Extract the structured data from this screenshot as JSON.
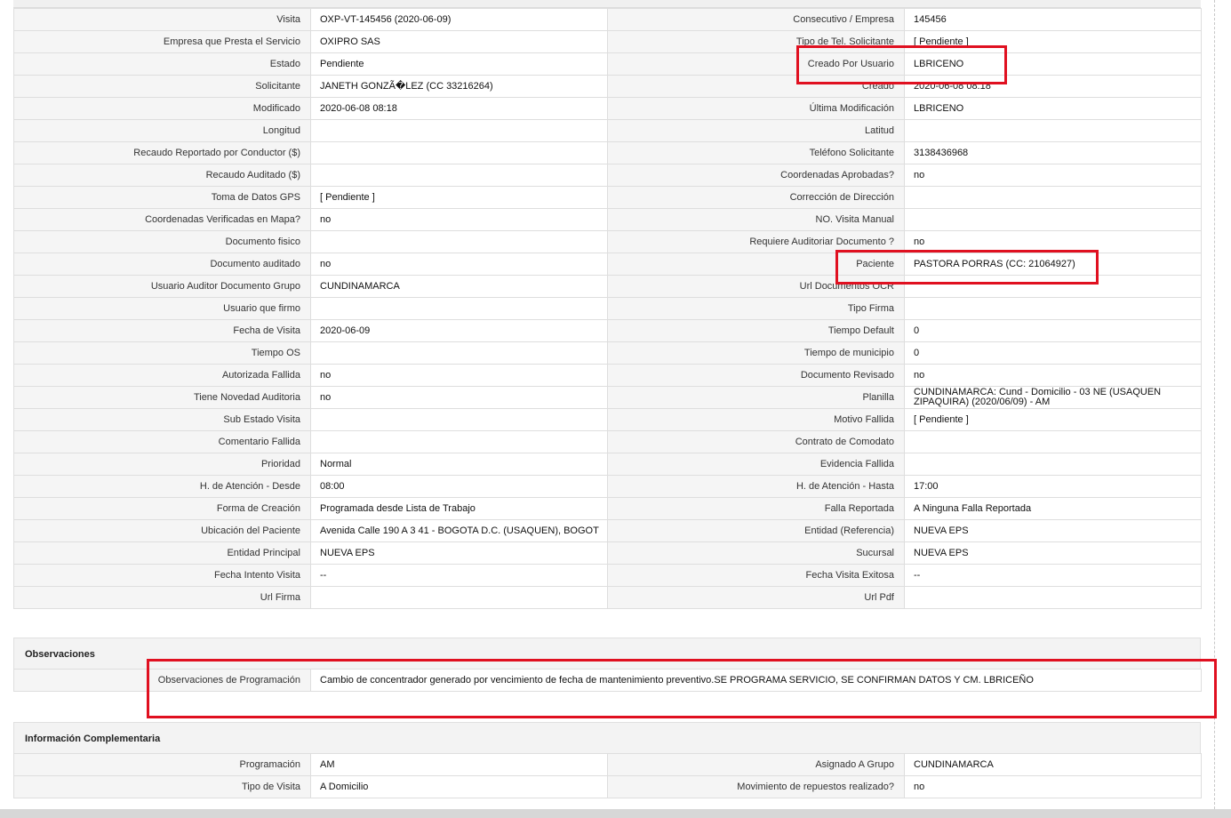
{
  "main_rows": [
    {
      "l1": "Visita",
      "v1": "OXP-VT-145456 (2020-06-09)",
      "l2": "Consecutivo / Empresa",
      "v2": "145456"
    },
    {
      "l1": "Empresa que Presta el Servicio",
      "v1": "OXIPRO SAS",
      "l2": "Tipo de Tel. Solicitante",
      "v2": "[ Pendiente ]"
    },
    {
      "l1": "Estado",
      "v1": "Pendiente",
      "l2": "Creado Por Usuario",
      "v2": "LBRICENO"
    },
    {
      "l1": "Solicitante",
      "v1": "JANETH GONZÃ�LEZ (CC 33216264)",
      "l2": "Creado",
      "v2": "2020-06-08 08:18"
    },
    {
      "l1": "Modificado",
      "v1": "2020-06-08 08:18",
      "l2": "Última Modificación",
      "v2": " LBRICENO"
    },
    {
      "l1": "Longitud",
      "v1": "",
      "l2": "Latitud",
      "v2": ""
    },
    {
      "l1": "Recaudo Reportado por Conductor ($)",
      "v1": "",
      "l2": "Teléfono Solicitante",
      "v2": "3138436968"
    },
    {
      "l1": "Recaudo Auditado ($)",
      "v1": "",
      "l2": "Coordenadas Aprobadas?",
      "v2": " no"
    },
    {
      "l1": "Toma de Datos GPS",
      "v1": "[ Pendiente ]",
      "l2": "Corrección de Dirección",
      "v2": ""
    },
    {
      "l1": "Coordenadas Verificadas en Mapa?",
      "v1": " no",
      "l2": "NO. Visita Manual",
      "v2": ""
    },
    {
      "l1": "Documento fisico",
      "v1": "",
      "l2": "Requiere Auditoriar Documento ?",
      "v2": " no"
    },
    {
      "l1": "Documento auditado",
      "v1": " no",
      "l2": "Paciente",
      "v2": "PASTORA PORRAS (CC: 21064927)"
    },
    {
      "l1": "Usuario Auditor Documento Grupo",
      "v1": "CUNDINAMARCA",
      "l2": "Url Documentos OCR",
      "v2": ""
    },
    {
      "l1": "Usuario que firmo",
      "v1": "",
      "l2": "Tipo Firma",
      "v2": ""
    },
    {
      "l1": "Fecha de Visita",
      "v1": " 2020-06-09",
      "l2": "Tiempo Default",
      "v2": "0"
    },
    {
      "l1": "Tiempo OS",
      "v1": "",
      "l2": "Tiempo de municipio",
      "v2": "0"
    },
    {
      "l1": "Autorizada Fallida",
      "v1": " no",
      "l2": "Documento Revisado",
      "v2": " no"
    },
    {
      "l1": "Tiene Novedad Auditoria",
      "v1": " no",
      "l2": "Planilla",
      "v2": "CUNDINAMARCA: Cund - Domicilio - 03 NE (USAQUEN ZIPAQUIRA) (2020/06/09) - AM"
    },
    {
      "l1": "Sub Estado Visita",
      "v1": "",
      "l2": "Motivo Fallida",
      "v2": "[ Pendiente ]"
    },
    {
      "l1": "Comentario Fallida",
      "v1": "",
      "l2": "Contrato de Comodato",
      "v2": ""
    },
    {
      "l1": "Prioridad",
      "v1": "Normal",
      "l2": "Evidencia Fallida",
      "v2": ""
    },
    {
      "l1": "H. de Atención - Desde",
      "v1": "08:00",
      "l2": "H. de Atención - Hasta",
      "v2": "17:00"
    },
    {
      "l1": "Forma de Creación",
      "v1": "Programada desde Lista de Trabajo",
      "l2": "Falla Reportada",
      "v2": "A Ninguna Falla Reportada"
    },
    {
      "l1": "Ubicación del Paciente",
      "v1": "Avenida Calle 190 A 3 41 - BOGOTA D.C. (USAQUEN), BOGOT",
      "l2": "Entidad (Referencia)",
      "v2": "NUEVA EPS"
    },
    {
      "l1": "Entidad Principal",
      "v1": "NUEVA EPS",
      "l2": "Sucursal",
      "v2": "NUEVA EPS"
    },
    {
      "l1": "Fecha Intento Visita",
      "v1": " --",
      "l2": "Fecha Visita Exitosa",
      "v2": " --"
    },
    {
      "l1": "Url Firma",
      "v1": "",
      "l2": "Url Pdf",
      "v2": ""
    }
  ],
  "observaciones": {
    "title": "Observaciones",
    "label": "Observaciones de Programación",
    "value": " Cambio de concentrador generado por vencimiento de fecha de mantenimiento preventivo.SE PROGRAMA SERVICIO, SE CONFIRMAN DATOS Y CM. LBRICEÑO"
  },
  "complementaria": {
    "title": "Información Complementaria",
    "rows": [
      {
        "l1": "Programación",
        "v1": "AM",
        "l2": "Asignado A Grupo",
        "v2": "CUNDINAMARCA"
      },
      {
        "l1": "Tipo de Visita",
        "v1": "A Domicilio",
        "l2": "Movimiento de repuestos realizado?",
        "v2": " no"
      }
    ]
  },
  "colors": {
    "highlight": "#e01020",
    "label_bg": "#f5f5f5",
    "border": "#dedede"
  }
}
